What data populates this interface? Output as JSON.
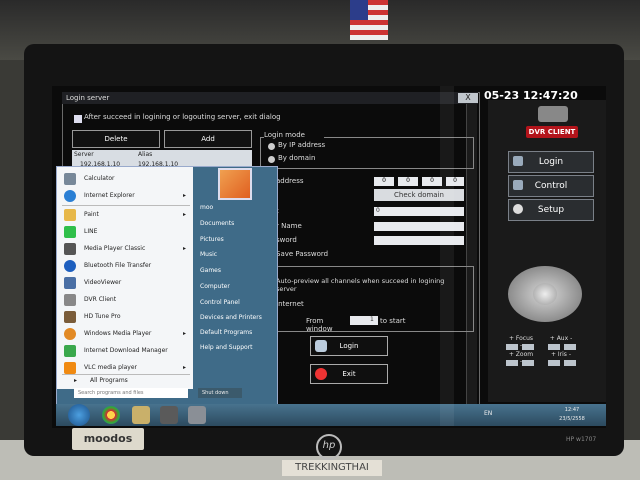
{
  "dvr": {
    "clock": "05-23 12:47:20",
    "logo_text": "DVR CLIENT",
    "buttons": [
      "Login",
      "Control",
      "Setup"
    ],
    "ptz_labels": [
      "+ Focus -",
      "+ Aux -",
      "+ Zoom -",
      "+ Iris -"
    ]
  },
  "dialog": {
    "title": "Login server",
    "close": "X",
    "auto_exit_label": "After succeed in logining or logouting server, exit dialog",
    "delete_label": "Delete",
    "add_label": "Add",
    "list_headers": [
      "Server",
      "Alias"
    ],
    "list_row": [
      "192.168.1.10",
      "192.168.1.10"
    ],
    "login_mode_title": "Login mode",
    "by_ip": "By IP address",
    "by_domain": "By domain",
    "ip_label": "address",
    "ip_fields": [
      "0",
      "0",
      "0",
      "0"
    ],
    "check_domain": "Check domain",
    "port_label": "t",
    "port_value": "0",
    "user_label": "r Name",
    "password_label": "sword",
    "save_password": "Save Password",
    "auto_preview": "Auto-preview all channels when succeed in logining server",
    "internet_label": "Internet",
    "from_window": "From window",
    "from_value": "1",
    "to_start": "to start",
    "login_button": "Login",
    "exit_button": "Exit"
  },
  "start_menu": {
    "user": "moo",
    "programs": [
      "Calculator",
      "Internet Explorer",
      "Paint",
      "LINE",
      "Media Player Classic",
      "Bluetooth File Transfer",
      "VideoViewer",
      "DVR Client",
      "HD Tune Pro",
      "Windows Media Player",
      "Internet Download Manager",
      "VLC media player"
    ],
    "all_programs": "All Programs",
    "search_placeholder": "Search programs and files",
    "right_items": [
      "Documents",
      "Pictures",
      "Music",
      "Games",
      "Computer",
      "Control Panel",
      "Devices and Printers",
      "Default Programs",
      "Help and Support"
    ],
    "shutdown": "Shut down"
  },
  "taskbar": {
    "lang": "EN",
    "time": "12:47",
    "date": "23/5/2558"
  },
  "monitor": {
    "sticker": "moodos",
    "brand": "hp",
    "model": "HP w1707",
    "stand_label": "TREKKINGTHAI"
  }
}
